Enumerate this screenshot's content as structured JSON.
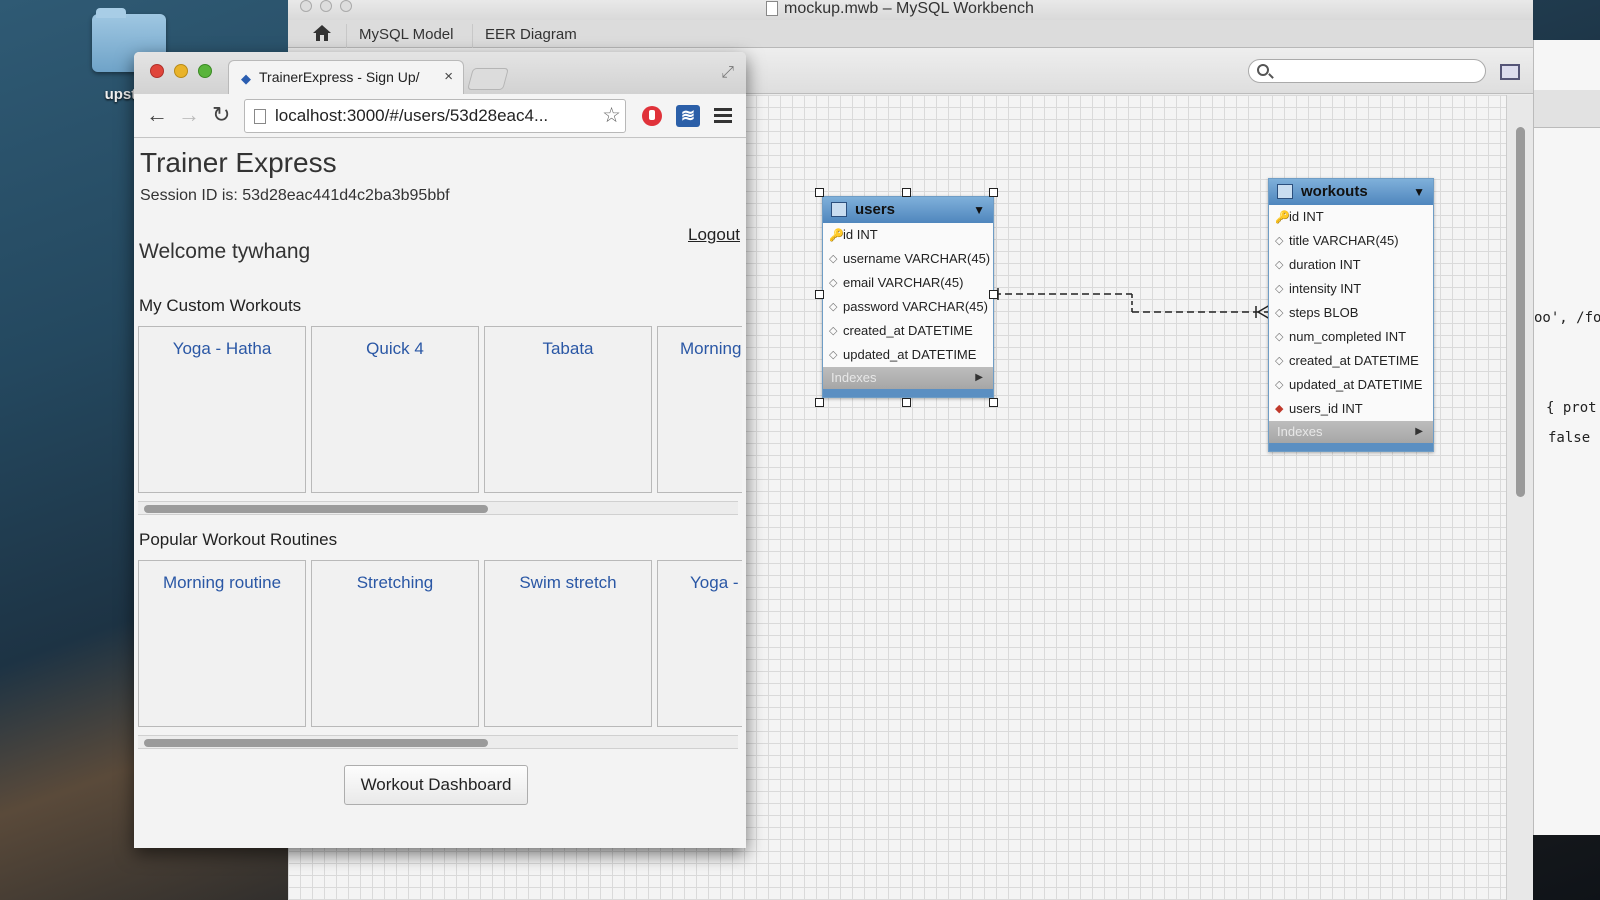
{
  "desktop": {
    "folder_label": "upstart"
  },
  "workbench": {
    "window_title": "mockup.mwb – MySQL Workbench",
    "tabs": [
      "MySQL Model",
      "EER Diagram"
    ],
    "tables": [
      {
        "name": "users",
        "columns": [
          {
            "text": "id INT",
            "kind": "pk"
          },
          {
            "text": "username VARCHAR(45)",
            "kind": "col"
          },
          {
            "text": "email VARCHAR(45)",
            "kind": "col"
          },
          {
            "text": "password VARCHAR(45)",
            "kind": "col"
          },
          {
            "text": "created_at DATETIME",
            "kind": "col"
          },
          {
            "text": "updated_at DATETIME",
            "kind": "col"
          }
        ],
        "indexes_label": "Indexes"
      },
      {
        "name": "workouts",
        "columns": [
          {
            "text": "id INT",
            "kind": "pk"
          },
          {
            "text": "title VARCHAR(45)",
            "kind": "col"
          },
          {
            "text": "duration INT",
            "kind": "col"
          },
          {
            "text": "intensity INT",
            "kind": "col"
          },
          {
            "text": "steps BLOB",
            "kind": "col"
          },
          {
            "text": "num_completed INT",
            "kind": "col"
          },
          {
            "text": "created_at DATETIME",
            "kind": "col"
          },
          {
            "text": "updated_at DATETIME",
            "kind": "col"
          },
          {
            "text": "users_id INT",
            "kind": "fk"
          }
        ],
        "indexes_label": "Indexes"
      }
    ]
  },
  "right_window": {
    "code_lines": [
      "oo', /fo",
      "{ prot",
      "false"
    ]
  },
  "browser": {
    "tab_title": "TrainerExpress - Sign Up/",
    "url": "localhost:3000/#/users/53d28eac4...",
    "page": {
      "title": "Trainer Express",
      "session": "Session ID is: 53d28eac441d4c2ba3b95bbf",
      "welcome": "Welcome tywhang",
      "logout": "Logout",
      "custom_title": "My Custom Workouts",
      "custom_workouts": [
        "Yoga - Hatha",
        "Quick 4",
        "Tabata",
        "Morning"
      ],
      "popular_title": "Popular Workout Routines",
      "popular_workouts": [
        "Morning routine",
        "Stretching",
        "Swim stretch",
        "Yoga -"
      ],
      "dashboard_button": "Workout Dashboard"
    }
  }
}
